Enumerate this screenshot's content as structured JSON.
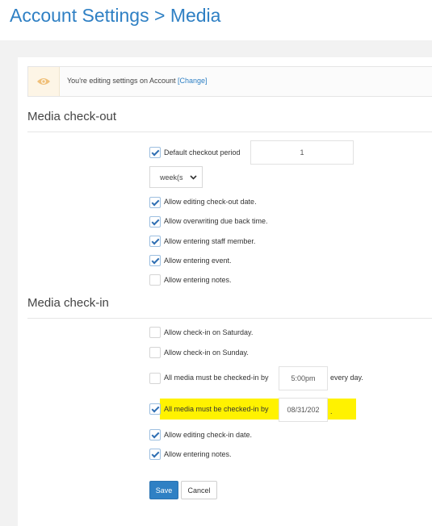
{
  "header": {
    "title": "Account Settings > Media"
  },
  "notice": {
    "icon": "eye-icon",
    "text": "You're editing settings on Account",
    "change_link": "[Change]"
  },
  "checkout": {
    "heading": "Media check-out",
    "default_period": {
      "label": "Default checkout period",
      "checked": true,
      "value": "1"
    },
    "period_unit": "week(s",
    "options": [
      {
        "label": "Allow editing check-out date.",
        "checked": true
      },
      {
        "label": "Allow overwriting due back time.",
        "checked": true
      },
      {
        "label": "Allow entering staff member.",
        "checked": true
      },
      {
        "label": "Allow entering event.",
        "checked": true
      },
      {
        "label": "Allow entering notes.",
        "checked": false
      }
    ]
  },
  "checkin": {
    "heading": "Media check-in",
    "options": [
      {
        "label": "Allow check-in on Saturday.",
        "checked": false
      },
      {
        "label": "Allow check-in on Sunday.",
        "checked": false
      }
    ],
    "daily_time": {
      "label": "All media must be checked-in by",
      "checked": false,
      "value": "5:00pm",
      "suffix": "every day."
    },
    "by_date": {
      "label": "All media must be checked-in by",
      "checked": true,
      "value": "08/31/202",
      "suffix": "."
    },
    "more_options": [
      {
        "label": "Allow editing check-in date.",
        "checked": true
      },
      {
        "label": "Allow entering notes.",
        "checked": true
      }
    ]
  },
  "buttons": {
    "save": "Save",
    "cancel": "Cancel"
  },
  "colors": {
    "accent": "#2f80c4",
    "highlight": "#fff200"
  }
}
